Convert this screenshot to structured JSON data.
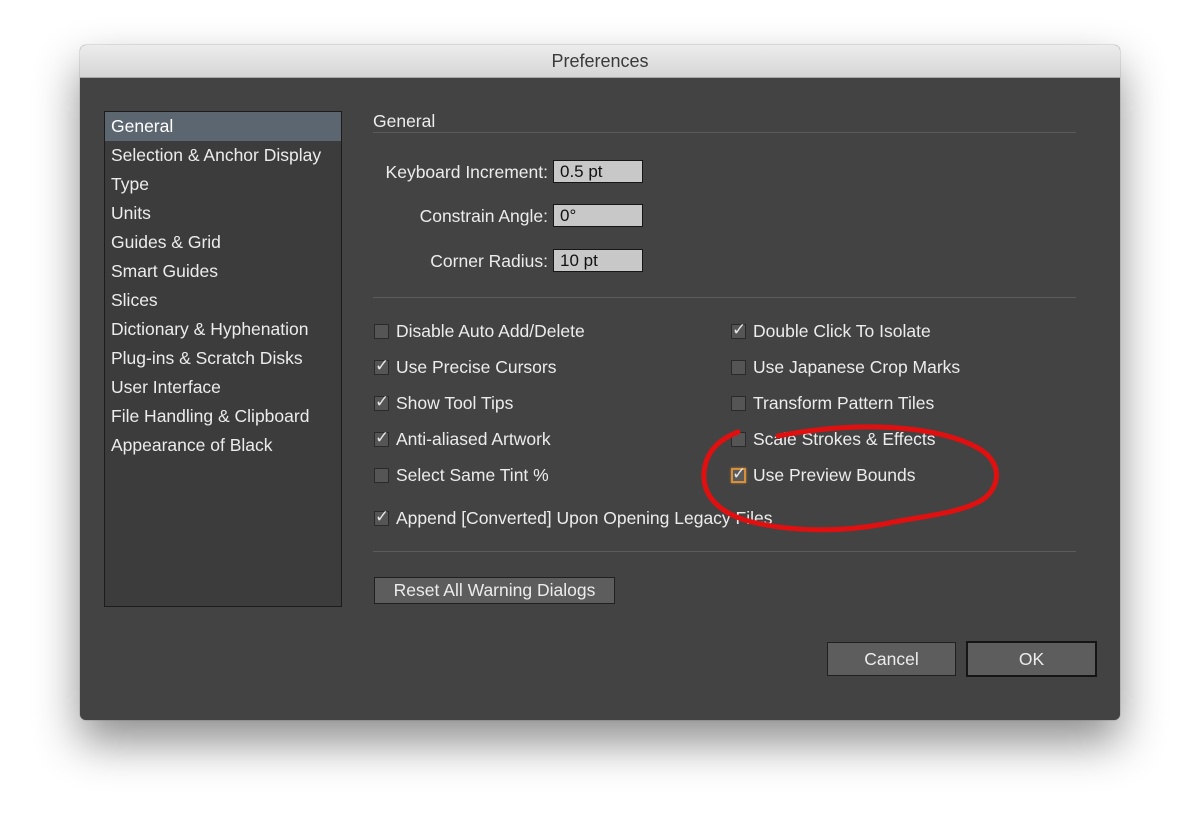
{
  "window": {
    "title": "Preferences"
  },
  "sidebar": {
    "items": [
      {
        "label": "General"
      },
      {
        "label": "Selection & Anchor Display"
      },
      {
        "label": "Type"
      },
      {
        "label": "Units"
      },
      {
        "label": "Guides & Grid"
      },
      {
        "label": "Smart Guides"
      },
      {
        "label": "Slices"
      },
      {
        "label": "Dictionary & Hyphenation"
      },
      {
        "label": "Plug-ins & Scratch Disks"
      },
      {
        "label": "User Interface"
      },
      {
        "label": "File Handling & Clipboard"
      },
      {
        "label": "Appearance of Black"
      }
    ],
    "selected": "General"
  },
  "panel": {
    "title": "General",
    "fields": {
      "keyboard_increment": {
        "label": "Keyboard Increment:",
        "value": "0.5 pt"
      },
      "constrain_angle": {
        "label": "Constrain Angle:",
        "value": "0°"
      },
      "corner_radius": {
        "label": "Corner Radius:",
        "value": "10 pt"
      }
    },
    "checkboxes": {
      "disable_auto_add_delete": {
        "label": "Disable Auto Add/Delete",
        "checked": false
      },
      "use_precise_cursors": {
        "label": "Use Precise Cursors",
        "checked": true
      },
      "show_tool_tips": {
        "label": "Show Tool Tips",
        "checked": true
      },
      "anti_aliased_artwork": {
        "label": "Anti-aliased Artwork",
        "checked": true
      },
      "select_same_tint": {
        "label": "Select Same Tint %",
        "checked": false
      },
      "append_converted": {
        "label": "Append [Converted] Upon Opening Legacy Files",
        "checked": true
      },
      "double_click_to_isolate": {
        "label": "Double Click To Isolate",
        "checked": true
      },
      "use_japanese_crop_marks": {
        "label": "Use Japanese Crop Marks",
        "checked": false
      },
      "transform_pattern_tiles": {
        "label": "Transform Pattern Tiles",
        "checked": false
      },
      "scale_strokes_effects": {
        "label": "Scale Strokes & Effects",
        "checked": false
      },
      "use_preview_bounds": {
        "label": "Use Preview Bounds",
        "checked": true
      }
    },
    "reset_button": "Reset All Warning Dialogs"
  },
  "footer": {
    "cancel_label": "Cancel",
    "ok_label": "OK"
  },
  "colors": {
    "window_bg": "#434343",
    "sidebar_selected": "#5c6670",
    "focus_ring": "#d88f3a",
    "annotation": "#e01010"
  }
}
